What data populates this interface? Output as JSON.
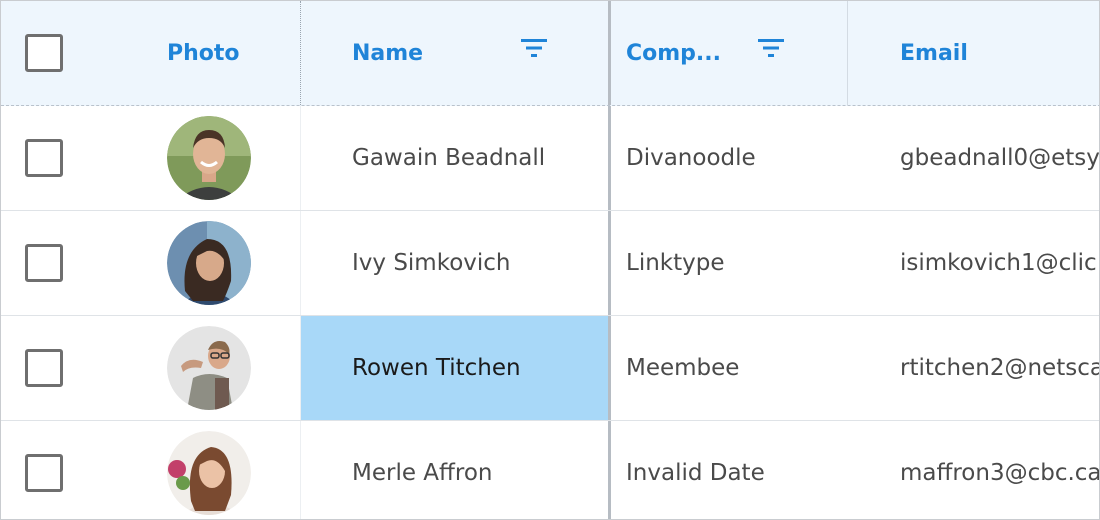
{
  "columns": {
    "photo": "Photo",
    "name": "Name",
    "company": "Comp...",
    "email": "Email"
  },
  "rows": [
    {
      "name": "Gawain Beadnall",
      "company": "Divanoodle",
      "email": "gbeadnall0@etsy",
      "avatar": "avatar-man-smiling",
      "selected": false
    },
    {
      "name": "Ivy Simkovich",
      "company": "Linktype",
      "email": "isimkovich1@clic",
      "avatar": "avatar-woman-dark-hair",
      "selected": false
    },
    {
      "name": "Rowen Titchen",
      "company": "Meembee",
      "email": "rtitchen2@netsca",
      "avatar": "avatar-man-glasses",
      "selected": true
    },
    {
      "name": "Merle Affron",
      "company": "Invalid Date",
      "email": "maffron3@cbc.ca",
      "avatar": "avatar-woman-flowers",
      "selected": false
    }
  ],
  "colors": {
    "header_bg": "#eef6fd",
    "header_text": "#1f84d8",
    "selected_cell_bg": "#a8d8f8",
    "cell_text": "#4a4a4a"
  }
}
